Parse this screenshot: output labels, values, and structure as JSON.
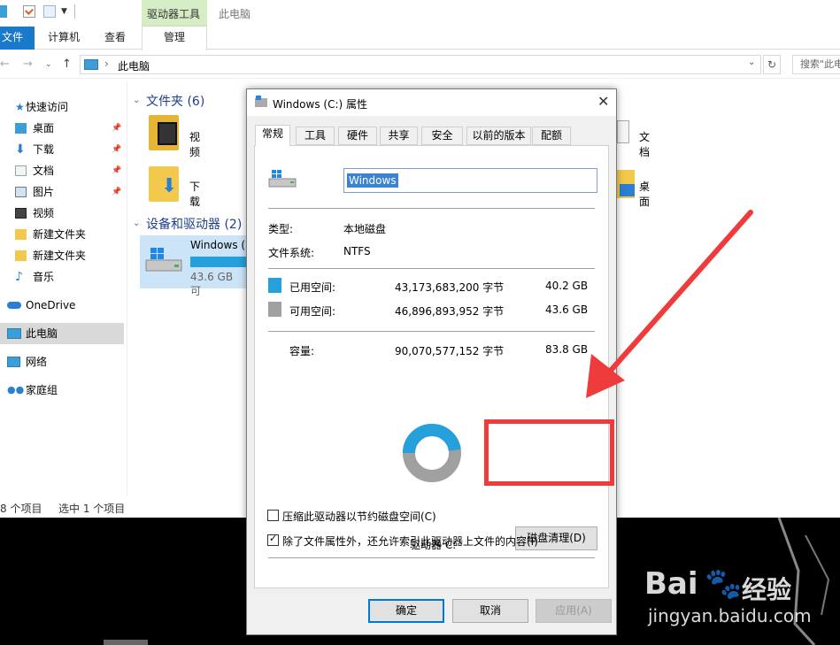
{
  "explorer": {
    "ribbon": {
      "context_group": "驱动器工具",
      "window_title": "此电脑",
      "tabs": {
        "file": "文件",
        "computer": "计算机",
        "view": "查看",
        "manage": "管理"
      }
    },
    "address": {
      "path": "此电脑",
      "search_placeholder": "搜索\"此电"
    },
    "nav_items": [
      {
        "label": "快速访问"
      },
      {
        "label": "桌面"
      },
      {
        "label": "下载"
      },
      {
        "label": "文档"
      },
      {
        "label": "图片"
      },
      {
        "label": "视频"
      },
      {
        "label": "新建文件夹"
      },
      {
        "label": "新建文件夹"
      },
      {
        "label": "音乐"
      },
      {
        "label": "OneDrive"
      },
      {
        "label": "此电脑"
      },
      {
        "label": "网络"
      },
      {
        "label": "家庭组"
      }
    ],
    "folders_section": "文件夹 (6)",
    "folders": {
      "video": "视频",
      "download": "下载",
      "docs": "文档",
      "desktop": "桌面"
    },
    "devices_section": "设备和驱动器 (2)",
    "drive": {
      "name": "Windows (",
      "free": "43.6 GB 可"
    },
    "status": {
      "count": "8 个项目",
      "selected": "选中 1 个项目"
    }
  },
  "dialog": {
    "title": "Windows (C:) 属性",
    "tabs": [
      "常规",
      "工具",
      "硬件",
      "共享",
      "安全",
      "以前的版本",
      "配额"
    ],
    "volume_name": "Windows",
    "type_label": "类型:",
    "type_value": "本地磁盘",
    "fs_label": "文件系统:",
    "fs_value": "NTFS",
    "used": {
      "label": "已用空间:",
      "bytes": "43,173,683,200 字节",
      "gb": "40.2 GB",
      "color": "#26a0da"
    },
    "free": {
      "label": "可用空间:",
      "bytes": "46,896,893,952 字节",
      "gb": "43.6 GB",
      "color": "#a0a0a0"
    },
    "capacity": {
      "label": "容量:",
      "bytes": "90,070,577,152 字节",
      "gb": "83.8 GB"
    },
    "used_fraction": 0.479,
    "drive_label": "驱动器 C:",
    "cleanup_button": "磁盘清理(D)",
    "compress_label": "压缩此驱动器以节约磁盘空间(C)",
    "index_label": "除了文件属性外，还允许索引此驱动器上文件的内容(I)",
    "buttons": {
      "ok": "确定",
      "cancel": "取消",
      "apply": "应用(A)"
    }
  },
  "watermark": {
    "brand": "Bai",
    "brand_cn": "经验",
    "url": "jingyan.baidu.com"
  }
}
